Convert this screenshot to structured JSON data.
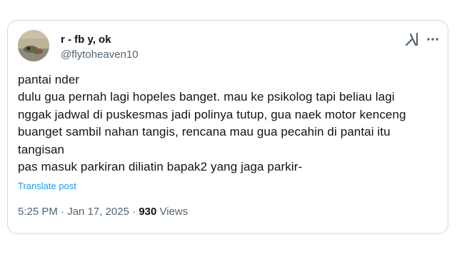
{
  "author": {
    "display_name": "r - fb y, ok",
    "handle": "@flytoheaven10",
    "avatar_icon": "avatar-photo"
  },
  "actions": {
    "grok_icon": "grok-icon",
    "more_icon": "more-icon"
  },
  "tweet": {
    "lines": [
      "pantai nder",
      "dulu gua pernah lagi hopeles banget. mau ke psikolog tapi beliau lagi",
      "nggak jadwal di puskesmas jadi polinya tutup, gua naek motor kenceng",
      "buanget sambil nahan tangis, rencana mau gua pecahin di pantai itu",
      "tangisan",
      "pas masuk parkiran diliatin bapak2 yang jaga parkir-"
    ],
    "translate_label": "Translate post"
  },
  "meta": {
    "time": "5:25 PM",
    "separator": " · ",
    "date": "Jan 17, 2025",
    "views_count": "930",
    "views_label": "Views"
  },
  "colors": {
    "text": "#0f1419",
    "secondary": "#536471",
    "link": "#1d9bf0",
    "border": "#cfd9de"
  }
}
